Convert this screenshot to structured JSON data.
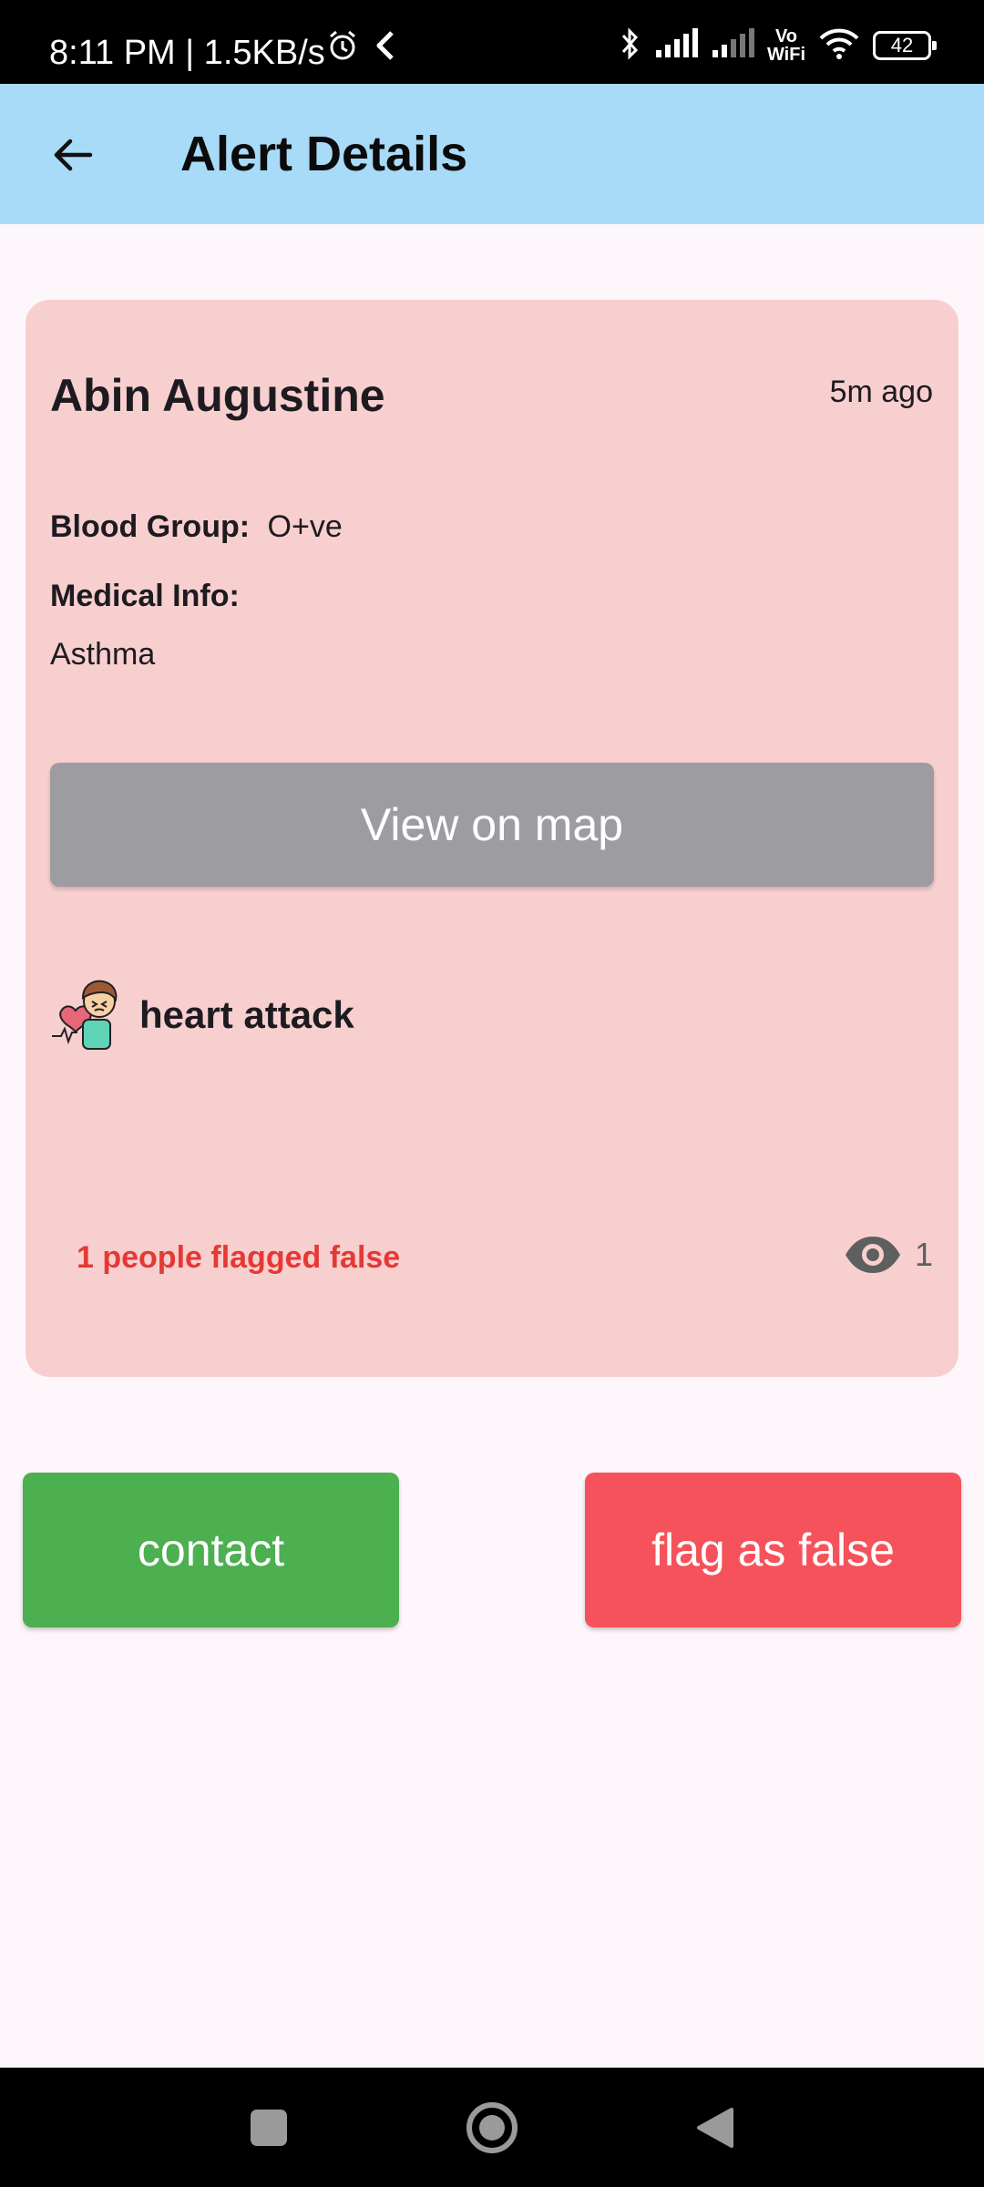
{
  "status_bar": {
    "time": "8:11 PM | 1.5KB/s",
    "icons": [
      "alarm-icon",
      "flash-icon",
      "bluetooth-icon",
      "signal-icon",
      "signal-weak-icon",
      "vowifi-icon",
      "wifi-icon",
      "battery-icon"
    ],
    "vowifi_top": "Vo",
    "vowifi_bottom": "WiFi",
    "battery": "42"
  },
  "app_bar": {
    "back_icon": "arrow-left-icon",
    "title": "Alert Details",
    "background": "#a8dbf8"
  },
  "alert": {
    "name": "Abin Augustine",
    "time_ago": "5m ago",
    "blood_group_label": "Blood Group:",
    "blood_group_value": "O+ve",
    "medical_info_label": "Medical Info:",
    "medical_info_value": "Asthma",
    "view_map_label": "View on map",
    "emergency_icon": "heart-attack-illustration-icon",
    "emergency_type": "heart attack",
    "flagged_text": "1 people flagged false",
    "view_icon": "eye-icon",
    "view_count": "1",
    "card_color": "#f8cfcf"
  },
  "actions": {
    "contact_label": "contact",
    "flag_label": "flag as false",
    "contact_color": "#4caf50",
    "flag_color": "#f5525b"
  },
  "nav_bar": {
    "icons": [
      "recents-square-icon",
      "home-circle-icon",
      "back-triangle-icon"
    ]
  }
}
